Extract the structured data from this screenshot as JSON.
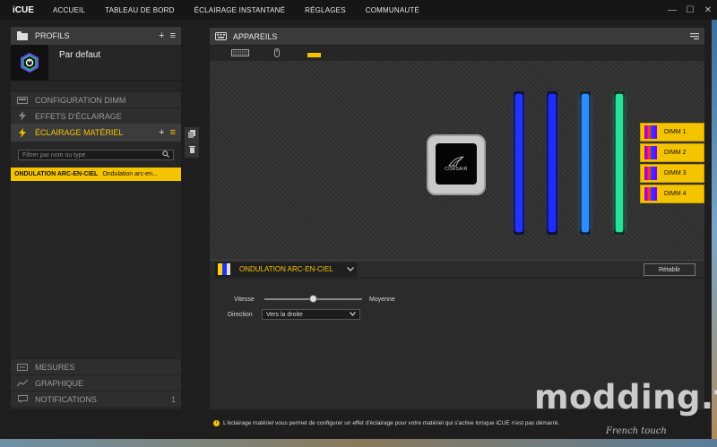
{
  "app": {
    "brand": "iCUE"
  },
  "nav": [
    "ACCUEIL",
    "TABLEAU DE BORD",
    "ÉCLAIRAGE INSTANTANÉ",
    "RÉGLAGES",
    "COMMUNAUTÉ"
  ],
  "window": {
    "minimize": "—",
    "maximize": "☐",
    "close": "✕"
  },
  "profiles": {
    "title": "PROFILS",
    "plus": "+",
    "menu": "≡",
    "profile_name": "Par defaut"
  },
  "left_sections": {
    "config_dimm": "CONFIGURATION DIMM",
    "effects": "EFFETS D'ÉCLAIRAGE",
    "hardware": "ÉCLAIRAGE MATÉRIEL",
    "filter_placeholder": "Filtrer par nom ou type",
    "effect_bold": "ONDULATION ARC-EN-CIEL",
    "effect_sub": "Ondulation arc-en...",
    "mesures": "MESURES",
    "graphique": "GRAPHIQUE",
    "notifications": "NOTIFICATIONS",
    "notif_count": "1"
  },
  "devices": {
    "title": "APPAREILS"
  },
  "pump_text": "CORSAIR",
  "dimms": [
    {
      "label": "DIMM 1"
    },
    {
      "label": "DIMM 2"
    },
    {
      "label": "DIMM 3"
    },
    {
      "label": "DIMM 4"
    }
  ],
  "stick_colors": [
    "#2233ff",
    "#1f2cff",
    "#2f8cff",
    "#29e29a"
  ],
  "effect_bar": {
    "selected": "ONDULATION ARC-EN-CIEL",
    "reset": "Rétablir"
  },
  "properties": {
    "speed_label": "Vitesse",
    "speed_value": "Moyenne",
    "speed_fraction": 0.5,
    "direction_label": "Direction",
    "direction_value": "Vers la droite"
  },
  "info": "L'éclairage matériel vous permet de configurer un effet d'éclairage pour votre matériel qui s'active lorsque iCUE n'est pas démarré.",
  "watermark": {
    "main": "modding.fr",
    "sub": "French touch"
  }
}
